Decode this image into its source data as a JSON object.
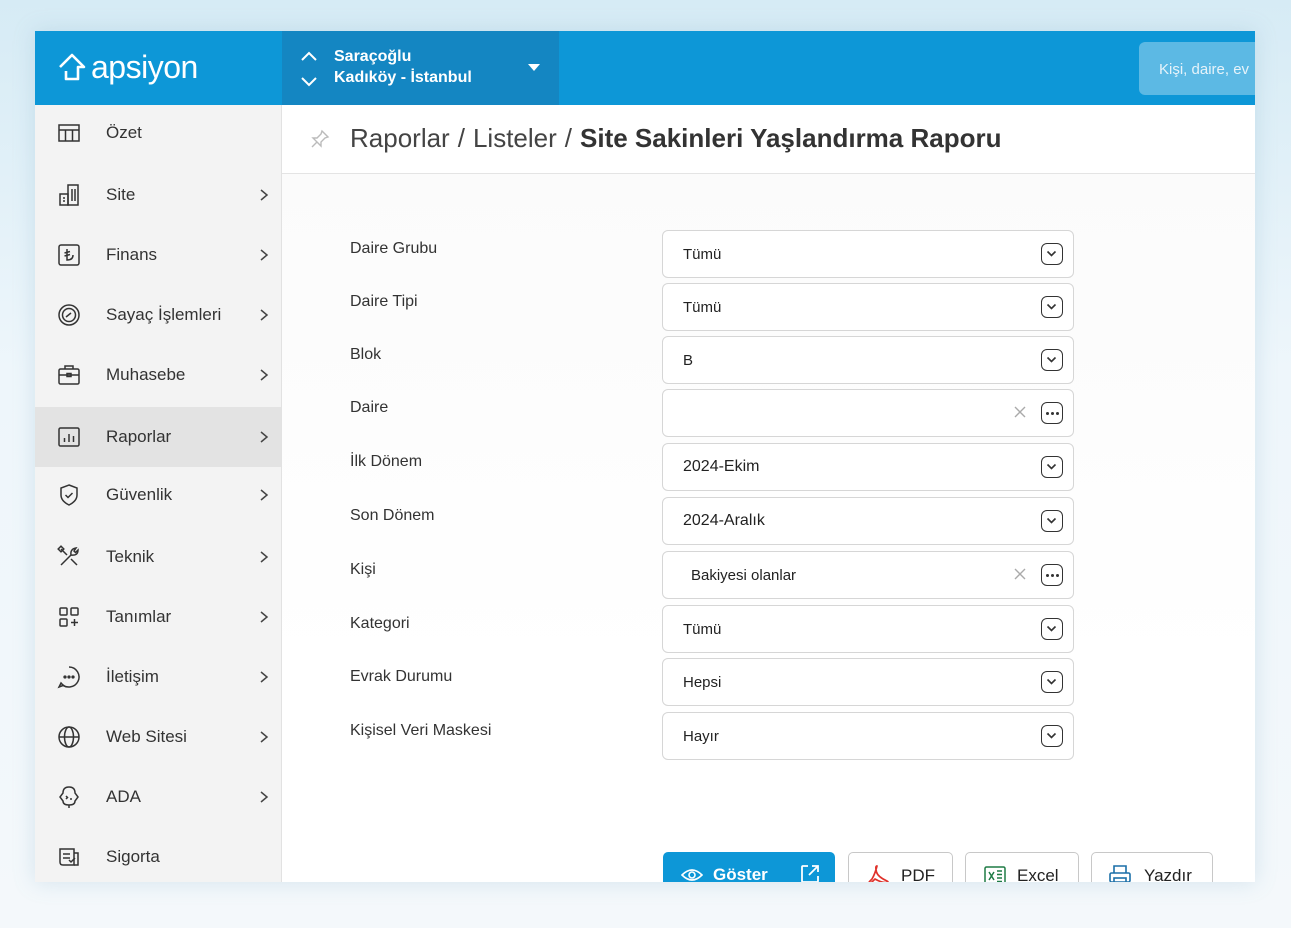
{
  "app": {
    "logo_text": "apsiyon"
  },
  "site": {
    "name": "Saraçoğlu",
    "location": "Kadıköy - İstanbul"
  },
  "search": {
    "placeholder": "Kişi, daire, ev"
  },
  "sidebar": {
    "items": [
      {
        "label": "Özet",
        "icon": "table-icon",
        "chevron": false
      },
      {
        "label": "Site",
        "icon": "building-icon",
        "chevron": true
      },
      {
        "label": "Finans",
        "icon": "lira-icon",
        "chevron": true
      },
      {
        "label": "Sayaç İşlemleri",
        "icon": "gauge-icon",
        "chevron": true
      },
      {
        "label": "Muhasebe",
        "icon": "briefcase-icon",
        "chevron": true
      },
      {
        "label": "Raporlar",
        "icon": "chart-icon",
        "chevron": true,
        "active": true
      },
      {
        "label": "Güvenlik",
        "icon": "shield-icon",
        "chevron": true
      },
      {
        "label": "Teknik",
        "icon": "tools-icon",
        "chevron": true
      },
      {
        "label": "Tanımlar",
        "icon": "grid-plus-icon",
        "chevron": true
      },
      {
        "label": "İletişim",
        "icon": "chat-icon",
        "chevron": true
      },
      {
        "label": "Web Sitesi",
        "icon": "globe-icon",
        "chevron": true
      },
      {
        "label": "ADA",
        "icon": "robot-icon",
        "chevron": true
      },
      {
        "label": "Sigorta",
        "icon": "document-icon",
        "chevron": false
      }
    ]
  },
  "breadcrumb": {
    "part1": "Raporlar",
    "part2": "Listeler",
    "current": "Site Sakinleri Yaşlandırma Raporu",
    "separator": "/"
  },
  "form": {
    "fields": [
      {
        "label": "Daire Grubu",
        "value": "Tümü",
        "control": "dropdown"
      },
      {
        "label": "Daire Tipi",
        "value": "Tümü",
        "control": "dropdown"
      },
      {
        "label": "Blok",
        "value": "B",
        "control": "dropdown"
      },
      {
        "label": "Daire",
        "value": "",
        "control": "lookup"
      },
      {
        "label": "İlk Dönem",
        "value": "2024-Ekim",
        "control": "dropdown"
      },
      {
        "label": "Son Dönem",
        "value": "2024-Aralık",
        "control": "dropdown"
      },
      {
        "label": "Kişi",
        "value": "Bakiyesi olanlar",
        "control": "lookup"
      },
      {
        "label": "Kategori",
        "value": "Tümü",
        "control": "dropdown"
      },
      {
        "label": "Evrak Durumu",
        "value": "Hepsi",
        "control": "dropdown"
      },
      {
        "label": "Kişisel Veri Maskesi",
        "value": "Hayır",
        "control": "dropdown"
      }
    ]
  },
  "actions": {
    "show": "Göster",
    "pdf": "PDF",
    "excel": "Excel",
    "print": "Yazdır"
  },
  "colors": {
    "brand": "#0d97d7",
    "site_selector": "#1486c2",
    "pdf_red": "#e0322b",
    "excel_green": "#1e7b45"
  }
}
